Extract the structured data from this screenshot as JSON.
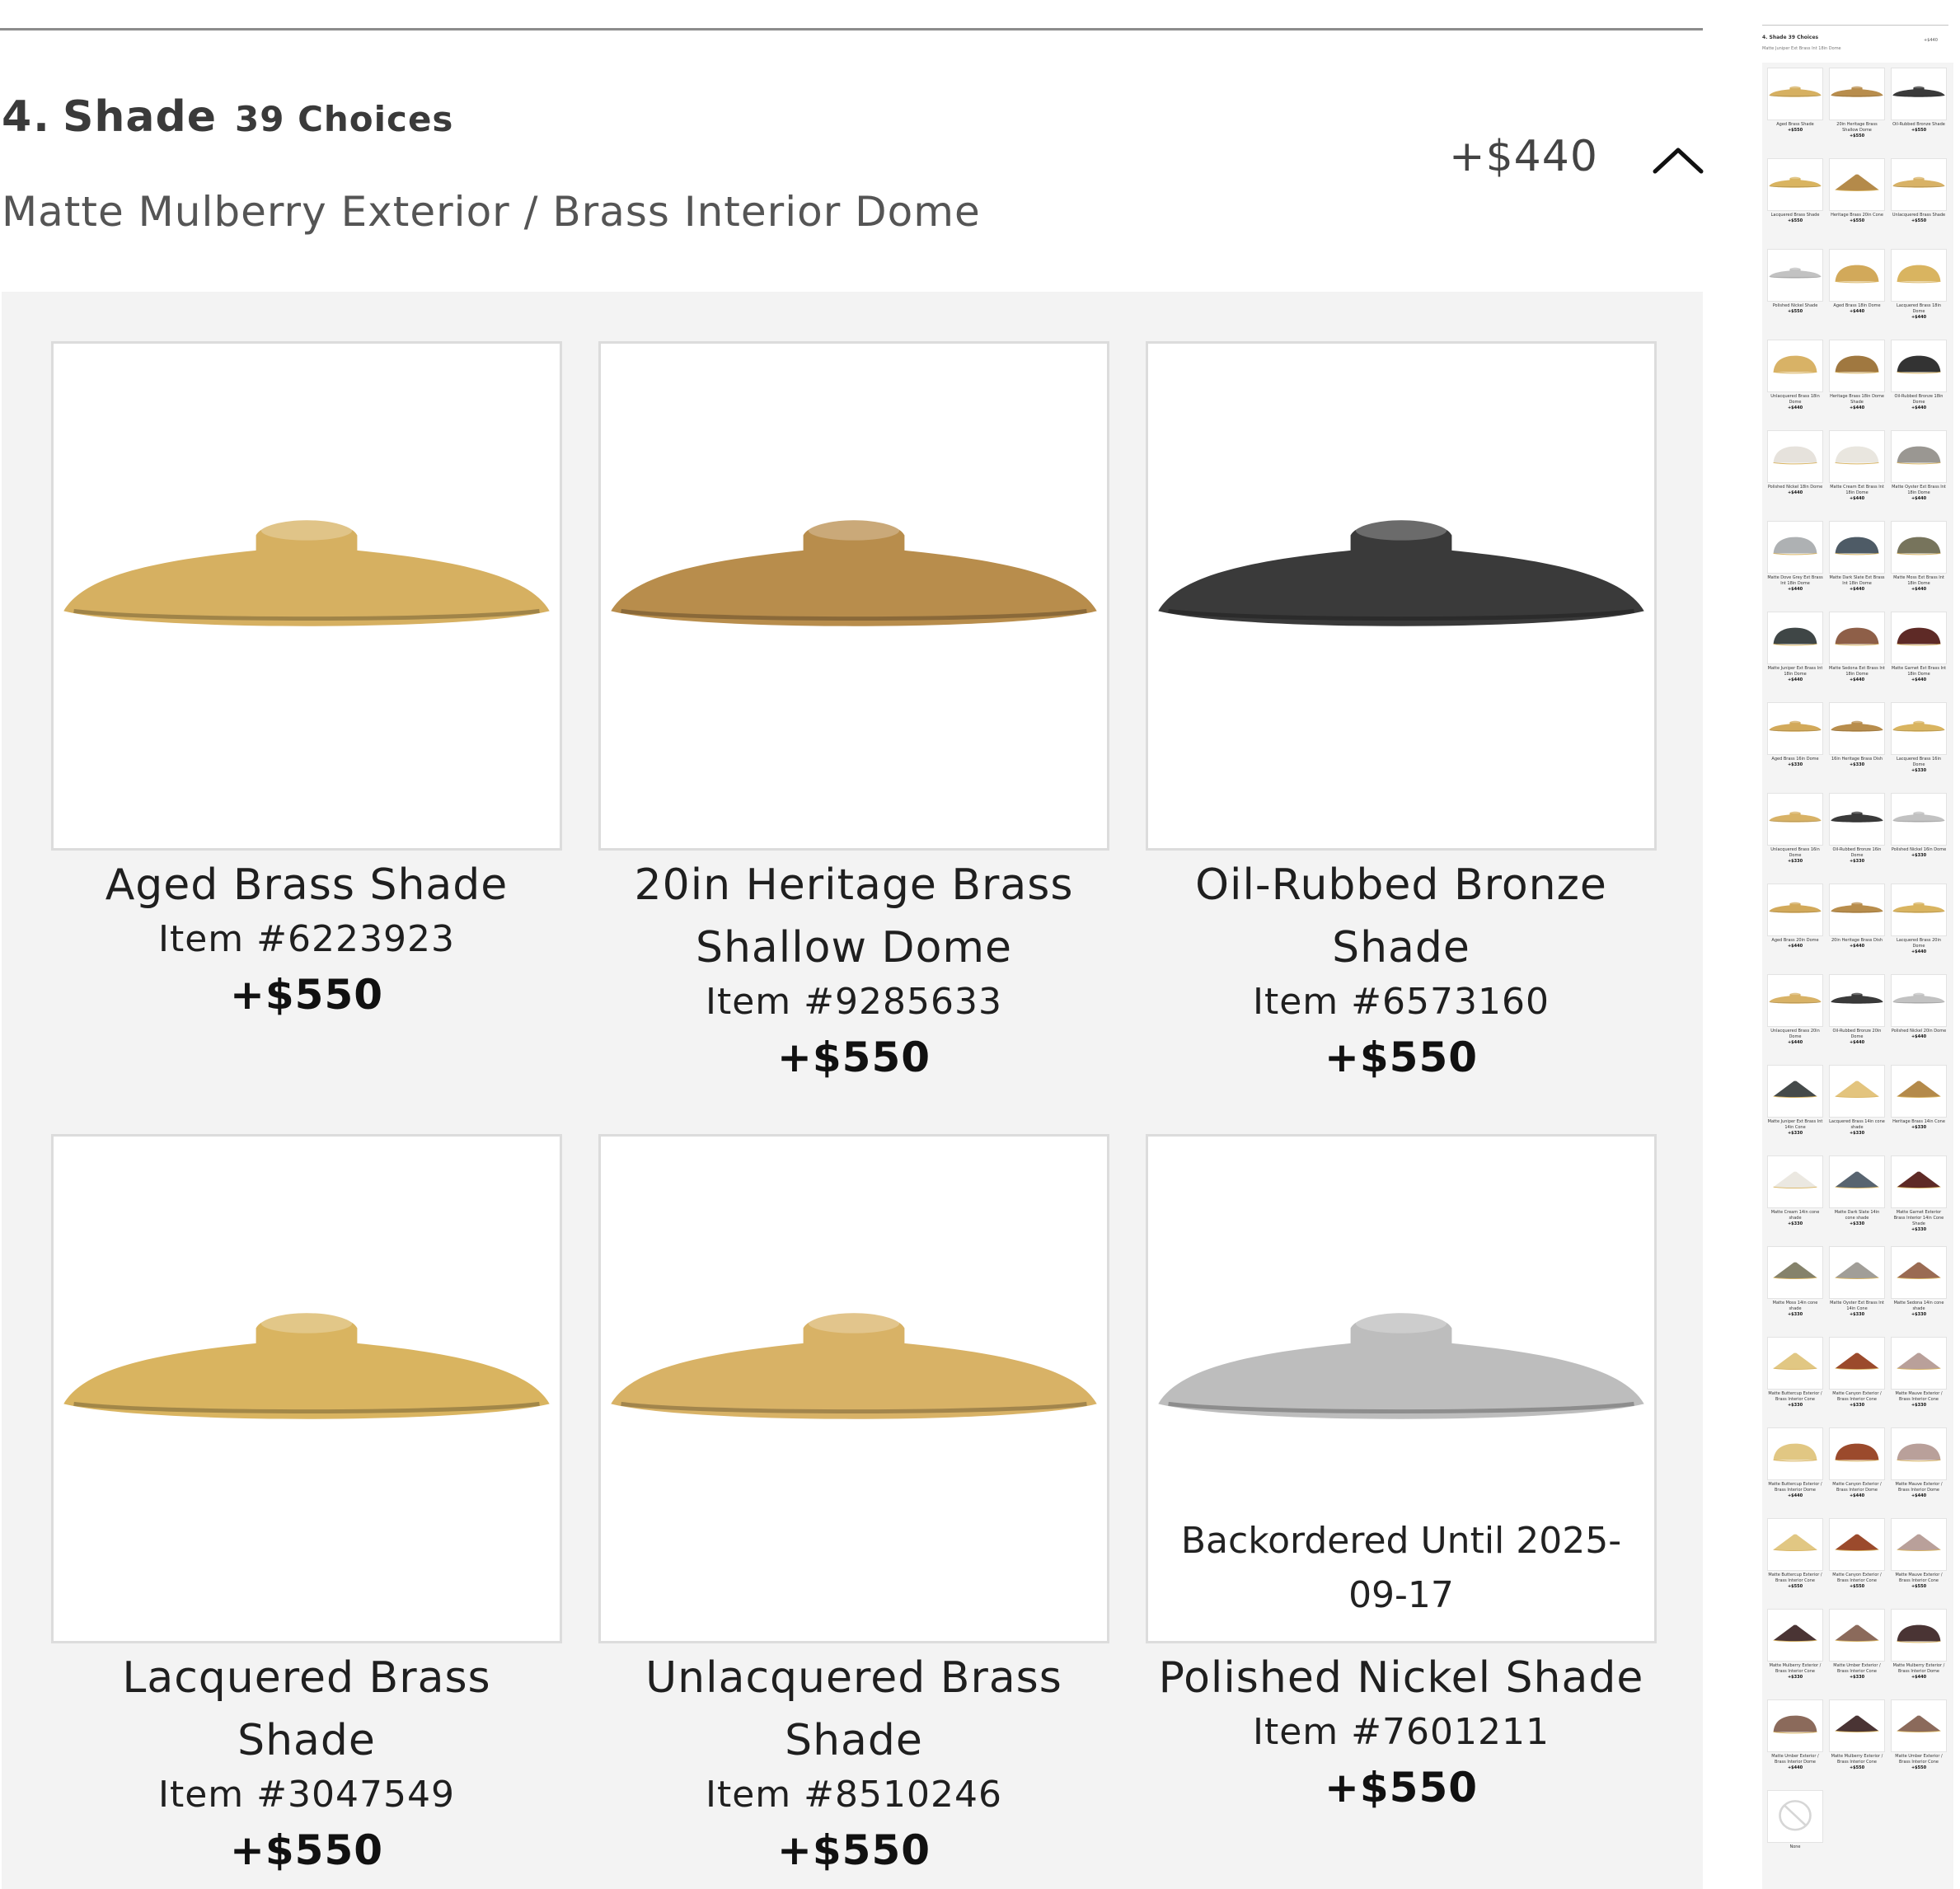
{
  "step": {
    "number": "4.",
    "title": "Shade",
    "choices": "39 Choices",
    "selected": "Matte Mulberry Exterior / Brass Interior Dome",
    "price": "+$440",
    "toggle_icon": "chevron-up-icon"
  },
  "cards": [
    {
      "name": "Aged Brass Shade",
      "item": "Item #6223923",
      "price": "+$550",
      "backorder": "",
      "color": "#d6b061",
      "shape": "disc"
    },
    {
      "name": "20in Heritage Brass Shallow Dome",
      "item": "Item #9285633",
      "price": "+$550",
      "backorder": "",
      "color": "#b88d4c",
      "shape": "disc"
    },
    {
      "name": "Oil-Rubbed Bronze Shade",
      "item": "Item #6573160",
      "price": "+$550",
      "backorder": "",
      "color": "#3a3a3a",
      "shape": "disc"
    },
    {
      "name": "Lacquered Brass Shade",
      "item": "Item #3047549",
      "price": "+$550",
      "backorder": "",
      "color": "#d9b460",
      "shape": "disc"
    },
    {
      "name": "Unlacquered Brass Shade",
      "item": "Item #8510246",
      "price": "+$550",
      "backorder": "",
      "color": "#d8b266",
      "shape": "disc"
    },
    {
      "name": "Polished Nickel Shade",
      "item": "Item #7601211",
      "price": "+$550",
      "backorder": "Backordered Until 2025-09-17",
      "color": "#bdbdbd",
      "shape": "disc"
    }
  ],
  "mini": {
    "heading": "4. Shade 39 Choices",
    "selected": "Matte Juniper Ext Brass Int 18in Dome",
    "price": "+$440",
    "items": [
      {
        "label": "Aged Brass Shade",
        "price": "+$550",
        "color": "#d6b061",
        "shape": "disc"
      },
      {
        "label": "20in Heritage Brass Shallow Dome",
        "price": "+$550",
        "color": "#b88d4c",
        "shape": "disc"
      },
      {
        "label": "Oil-Rubbed Bronze Shade",
        "price": "+$550",
        "color": "#3a3a3a",
        "shape": "disc"
      },
      {
        "label": "Lacquered Brass Shade",
        "price": "+$550",
        "color": "#d9b460",
        "shape": "disc"
      },
      {
        "label": "Heritage Brass 20in Cone",
        "price": "+$550",
        "color": "#b48a4a",
        "shape": "cone"
      },
      {
        "label": "Unlacquered Brass Shade",
        "price": "+$550",
        "color": "#d8b266",
        "shape": "disc"
      },
      {
        "label": "Polished Nickel Shade",
        "price": "+$550",
        "color": "#c2c2c2",
        "shape": "disc"
      },
      {
        "label": "Aged Brass 18in Dome",
        "price": "+$440",
        "color": "#d2a95a",
        "shape": "dome"
      },
      {
        "label": "Lacquered Brass 18in Dome",
        "price": "+$440",
        "color": "#d9b460",
        "shape": "dome"
      },
      {
        "label": "Unlacquered Brass 18in Dome",
        "price": "+$440",
        "color": "#d8b266",
        "shape": "dome"
      },
      {
        "label": "Heritage Brass 18in Dome Shade",
        "price": "+$440",
        "color": "#a07840",
        "shape": "dome"
      },
      {
        "label": "Oil-Rubbed Bronze 18in Dome",
        "price": "+$440",
        "color": "#333333",
        "shape": "dome"
      },
      {
        "label": "Polished Nickel 18in Dome",
        "price": "+$440",
        "color": "#e6e2dc",
        "shape": "dome"
      },
      {
        "label": "Matte Cream Ext Brass Int 18in Dome",
        "price": "+$440",
        "color": "#e9e6df",
        "shape": "dome"
      },
      {
        "label": "Matte Oyster Ext Brass Int 18in Dome",
        "price": "+$440",
        "color": "#9a9792",
        "shape": "dome"
      },
      {
        "label": "Matte Dove Grey Ext Brass Int 18in Dome",
        "price": "+$440",
        "color": "#aeb1b3",
        "shape": "dome"
      },
      {
        "label": "Matte Dark Slate Ext Brass Int 18in Dome",
        "price": "+$440",
        "color": "#4e5b66",
        "shape": "dome"
      },
      {
        "label": "Matte Moss Ext Brass Int 18in Dome",
        "price": "+$440",
        "color": "#77745c",
        "shape": "dome"
      },
      {
        "label": "Matte Juniper Ext Brass Int 18in Dome",
        "price": "+$440",
        "color": "#3f4646",
        "shape": "dome"
      },
      {
        "label": "Matte Sedona Ext Brass Int 18in Dome",
        "price": "+$440",
        "color": "#8e5f48",
        "shape": "dome"
      },
      {
        "label": "Matte Garnet Ext Brass Int 18in Dome",
        "price": "+$440",
        "color": "#5e2a26",
        "shape": "dome"
      },
      {
        "label": "Aged Brass 16in Dome",
        "price": "+$330",
        "color": "#d2a95a",
        "shape": "disc"
      },
      {
        "label": "16in Heritage Brass Dish",
        "price": "+$330",
        "color": "#b88d4c",
        "shape": "disc"
      },
      {
        "label": "Lacquered Brass 16in Dome",
        "price": "+$330",
        "color": "#d9b460",
        "shape": "disc"
      },
      {
        "label": "Unlacquered Brass 16in Dome",
        "price": "+$330",
        "color": "#d8b266",
        "shape": "disc"
      },
      {
        "label": "Oil-Rubbed Bronze 16in Dome",
        "price": "+$330",
        "color": "#3a3a3a",
        "shape": "disc"
      },
      {
        "label": "Polished Nickel 16in Dome",
        "price": "+$330",
        "color": "#c2c2c2",
        "shape": "disc"
      },
      {
        "label": "Aged Brass 20in Dome",
        "price": "+$440",
        "color": "#d2a95a",
        "shape": "disc"
      },
      {
        "label": "20in Heritage Brass Dish",
        "price": "+$440",
        "color": "#b88d4c",
        "shape": "disc"
      },
      {
        "label": "Lacquered Brass 20in Dome",
        "price": "+$440",
        "color": "#d9b460",
        "shape": "disc"
      },
      {
        "label": "Unlacquered Brass 20in Dome",
        "price": "+$440",
        "color": "#d8b266",
        "shape": "disc"
      },
      {
        "label": "Oil-Rubbed Bronze 20in Dome",
        "price": "+$440",
        "color": "#3a3a3a",
        "shape": "disc"
      },
      {
        "label": "Polished Nickel 20in Dome",
        "price": "+$440",
        "color": "#c2c2c2",
        "shape": "disc"
      },
      {
        "label": "Matte Juniper Ext Brass Int 14in Cone",
        "price": "+$330",
        "color": "#454a4a",
        "shape": "cone"
      },
      {
        "label": "Lacquered Brass 14in cone shade",
        "price": "+$330",
        "color": "#e3c47e",
        "shape": "cone"
      },
      {
        "label": "Heritage Brass 14in Cone",
        "price": "+$330",
        "color": "#b48a4a",
        "shape": "cone"
      },
      {
        "label": "Matte Cream 14in cone shade",
        "price": "+$330",
        "color": "#ebe8e1",
        "shape": "cone"
      },
      {
        "label": "Matte Dark Slate 14in cone shade",
        "price": "+$330",
        "color": "#586470",
        "shape": "cone"
      },
      {
        "label": "Matte Garnet Exterior Brass Interior 14in Cone Shade",
        "price": "+$330",
        "color": "#5e2a26",
        "shape": "cone"
      },
      {
        "label": "Matte Moss 14in cone shade",
        "price": "+$330",
        "color": "#85826b",
        "shape": "cone"
      },
      {
        "label": "Matte Oyster Ext Brass Int 14in Cone",
        "price": "+$330",
        "color": "#a19e98",
        "shape": "cone"
      },
      {
        "label": "Matte Sedona 14in cone shade",
        "price": "+$330",
        "color": "#9a6b53",
        "shape": "cone"
      },
      {
        "label": "Matte Buttercup Exterior / Brass Interior Cone",
        "price": "+$330",
        "color": "#e1c783",
        "shape": "cone"
      },
      {
        "label": "Matte Canyon Exterior / Brass Interior Cone",
        "price": "+$330",
        "color": "#9b4a2c",
        "shape": "cone"
      },
      {
        "label": "Matte Mauve Exterior / Brass Interior Cone",
        "price": "+$330",
        "color": "#b9a09a",
        "shape": "cone"
      },
      {
        "label": "Matte Buttercup Exterior / Brass Interior Dome",
        "price": "+$440",
        "color": "#e1c783",
        "shape": "dome"
      },
      {
        "label": "Matte Canyon Exterior / Brass Interior Dome",
        "price": "+$440",
        "color": "#9b4a2c",
        "shape": "dome"
      },
      {
        "label": "Matte Mauve Exterior / Brass Interior Dome",
        "price": "+$440",
        "color": "#b9a09a",
        "shape": "dome"
      },
      {
        "label": "Matte Buttercup Exterior / Brass Interior Cone",
        "price": "+$550",
        "color": "#e1c783",
        "shape": "cone"
      },
      {
        "label": "Matte Canyon Exterior / Brass Interior Cone",
        "price": "+$550",
        "color": "#9b4a2c",
        "shape": "cone"
      },
      {
        "label": "Matte Mauve Exterior / Brass Interior Cone",
        "price": "+$550",
        "color": "#b9a09a",
        "shape": "cone"
      },
      {
        "label": "Matte Mulberry Exterior / Brass Interior Cone",
        "price": "+$330",
        "color": "#4a3434",
        "shape": "cone"
      },
      {
        "label": "Matte Umber Exterior / Brass Interior Cone",
        "price": "+$330",
        "color": "#8b6a5b",
        "shape": "cone"
      },
      {
        "label": "Matte Mulberry Exterior / Brass Interior Dome",
        "price": "+$440",
        "color": "#4a3434",
        "shape": "dome"
      },
      {
        "label": "Matte Umber Exterior / Brass Interior Dome",
        "price": "+$440",
        "color": "#8b6a5b",
        "shape": "dome"
      },
      {
        "label": "Matte Mulberry Exterior / Brass Interior Cone",
        "price": "+$550",
        "color": "#4a3434",
        "shape": "cone"
      },
      {
        "label": "Matte Umber Exterior / Brass Interior Cone",
        "price": "+$550",
        "color": "#8b6a5b",
        "shape": "cone"
      },
      {
        "label": "None",
        "price": "",
        "color": "#d6d6d6",
        "shape": "none"
      }
    ]
  }
}
